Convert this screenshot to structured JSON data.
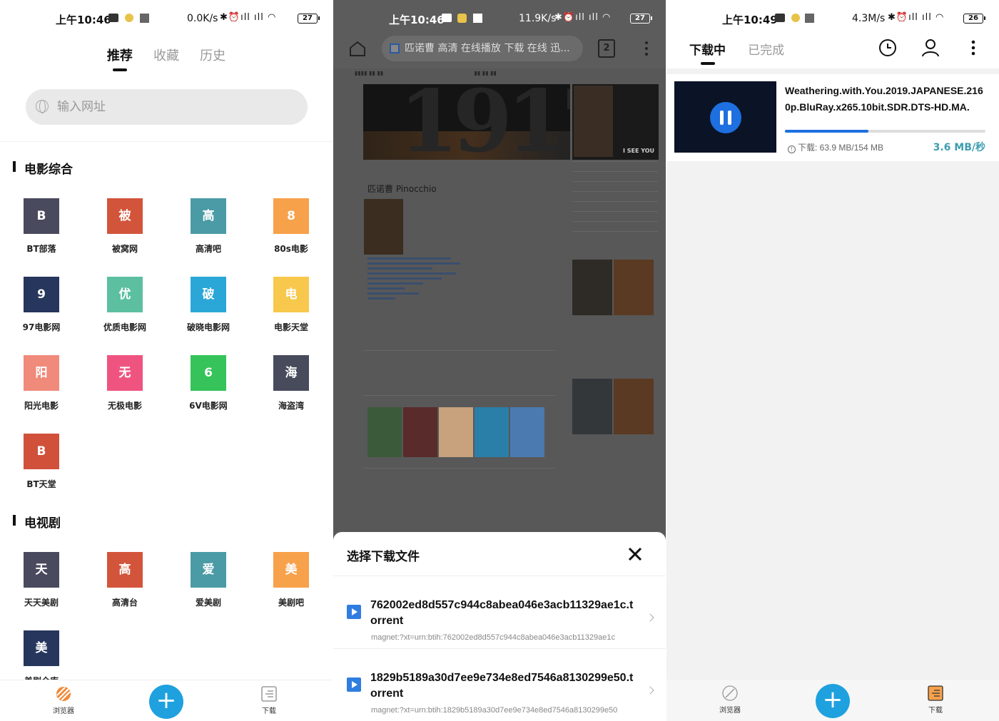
{
  "panel1": {
    "status": {
      "time": "上午10:46",
      "speed": "0.0K/s",
      "battery": "27"
    },
    "tabs": [
      {
        "label": "推荐",
        "active": true
      },
      {
        "label": "收藏",
        "active": false
      },
      {
        "label": "历史",
        "active": false
      }
    ],
    "url_placeholder": "输入网址",
    "sections": [
      {
        "title": "电影综合",
        "sites": [
          {
            "glyph": "B",
            "label": "BT部落",
            "color": "#4a4a5e"
          },
          {
            "glyph": "被",
            "label": "被窝网",
            "color": "#d2553b"
          },
          {
            "glyph": "高",
            "label": "高清吧",
            "color": "#4a9ba6"
          },
          {
            "glyph": "8",
            "label": "80s电影",
            "color": "#f7a14b"
          },
          {
            "glyph": "9",
            "label": "97电影网",
            "color": "#26365c"
          },
          {
            "glyph": "优",
            "label": "优质电影网",
            "color": "#5cc0a0"
          },
          {
            "glyph": "破",
            "label": "破晓电影网",
            "color": "#2aa7d7"
          },
          {
            "glyph": "电",
            "label": "电影天堂",
            "color": "#f7c84b"
          },
          {
            "glyph": "阳",
            "label": "阳光电影",
            "color": "#f08a7b"
          },
          {
            "glyph": "无",
            "label": "无极电影",
            "color": "#ef5480"
          },
          {
            "glyph": "6",
            "label": "6V电影网",
            "color": "#35c35a"
          },
          {
            "glyph": "海",
            "label": "海盗湾",
            "color": "#474b5c"
          },
          {
            "glyph": "B",
            "label": "BT天堂",
            "color": "#d0503a"
          }
        ]
      },
      {
        "title": "电视剧",
        "sites": [
          {
            "glyph": "天",
            "label": "天天美剧",
            "color": "#4a4a5e"
          },
          {
            "glyph": "高",
            "label": "高清台",
            "color": "#d2553b"
          },
          {
            "glyph": "爱",
            "label": "爱美剧",
            "color": "#4a9ba6"
          },
          {
            "glyph": "美",
            "label": "美剧吧",
            "color": "#f7a14b"
          },
          {
            "glyph": "美",
            "label": "美剧仓库",
            "color": "#26365c"
          }
        ]
      }
    ],
    "nav": {
      "browser": "浏览器",
      "download": "下载",
      "fab": "+"
    }
  },
  "panel2": {
    "status": {
      "time": "上午10:46",
      "speed": "11.9K/s",
      "battery": "27"
    },
    "url_text": "匹诺曹 高清 在线播放 下载 在线 迅...",
    "tab_count": "2",
    "webpage": {
      "movie_title": "匹诺曹 Pinocchio",
      "hero_text": "1917",
      "side_poster_text": "I SEE YOU"
    },
    "sheet": {
      "title": "选择下载文件",
      "files": [
        {
          "name": "762002ed8d557c944c8abea046e3acb11329ae1c.torrent",
          "magnet": "magnet:?xt=urn:btih:762002ed8d557c944c8abea046e3acb11329ae1c"
        },
        {
          "name": "1829b5189a30d7ee9e734e8ed7546a8130299e50.torrent",
          "magnet": "magnet:?xt=urn:btih:1829b5189a30d7ee9e734e8ed7546a8130299e50"
        }
      ]
    }
  },
  "panel3": {
    "status": {
      "time": "上午10:49",
      "speed": "4.3M/s",
      "battery": "26"
    },
    "tabs": [
      {
        "label": "下载中",
        "active": true
      },
      {
        "label": "已完成",
        "active": false
      }
    ],
    "download": {
      "name": "Weathering.with.You.2019.JAPANESE.2160p.BluRay.x265.10bit.SDR.DTS-HD.MA.",
      "progress": 0.415,
      "size_text": "下载: 63.9 MB/154 MB",
      "speed": "3.6 MB/秒"
    },
    "nav": {
      "browser": "浏览器",
      "download": "下载",
      "fab": "+"
    }
  }
}
